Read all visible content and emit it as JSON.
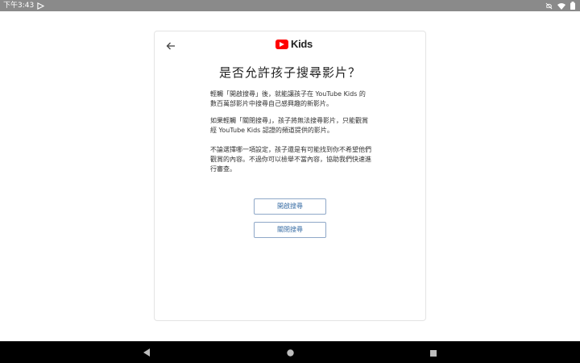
{
  "status_bar": {
    "time": "下午3:43",
    "icons": [
      "play-store-notification-icon",
      "mute-icon",
      "wifi-icon",
      "battery-icon"
    ]
  },
  "header": {
    "back_icon": "arrow-left-icon",
    "logo_text": "Kids",
    "logo_color": "#ff0000"
  },
  "title": "是否允許孩子搜尋影片？",
  "paragraphs": [
    "輕觸「開啟搜尋」後，就能讓孩子在 YouTube Kids 的數百萬部影片中搜尋自己感興趣的新影片。",
    "如果輕觸「關閉搜尋」，孩子將無法搜尋影片，只能觀賞經 YouTube Kids 認證的頻道提供的影片。",
    "不論選擇哪一項設定，孩子還是有可能找到你不希望他們觀賞的內容。不過你可以檢舉不當內容，協助我們快速進行審查。"
  ],
  "buttons": {
    "enable_search": "開啟搜尋",
    "disable_search": "關閉搜尋"
  },
  "colors": {
    "accent": "#3a6ea5",
    "status_bar": "#8a8a8a",
    "nav_bar": "#000000"
  },
  "nav_bar": {
    "icons": [
      "back-triangle-icon",
      "home-circle-icon",
      "recents-square-icon"
    ]
  }
}
